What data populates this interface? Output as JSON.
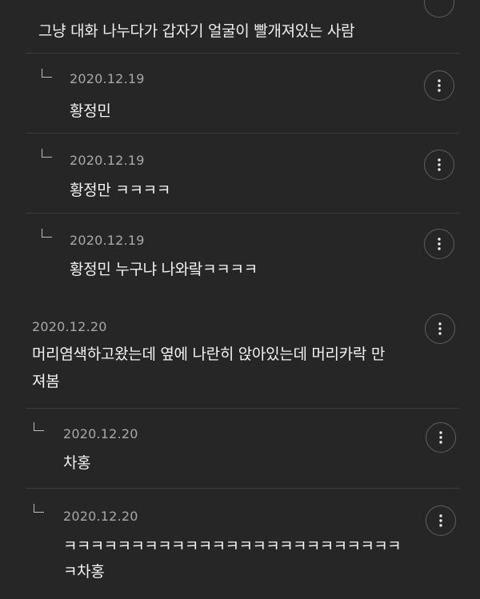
{
  "top_comment": {
    "text": "그냥 대화 나누다가 갑자기 얼굴이 빨개져있는 사람",
    "more_icon": "more-vertical-icon"
  },
  "comments": [
    {
      "type": "reply",
      "date": "2020.12.19",
      "text": "황정민"
    },
    {
      "type": "reply",
      "date": "2020.12.19",
      "text": "황정만 ㅋㅋㅋㅋ"
    },
    {
      "type": "reply",
      "date": "2020.12.19",
      "text": "황정민 누구냐 나와랔ㅋㅋㅋㅋ"
    },
    {
      "type": "comment",
      "date": "2020.12.20",
      "text_line1": "머리염색하고왔는데 옆에 나란히 앉아있는데 머리카락 만",
      "text_line2": "져봄"
    },
    {
      "type": "reply",
      "date": "2020.12.20",
      "text": "차홍"
    },
    {
      "type": "reply",
      "date": "2020.12.20",
      "text_line1": "ㅋㅋㅋㅋㅋㅋㅋㅋㅋㅋㅋㅋㅋㅋㅋㅋㅋㅋㅋㅋㅋㅋㅋㅋㅋ",
      "text_line2": "ㅋ차홍"
    }
  ],
  "icons": {
    "reply": "reply-arrow-icon",
    "more": "more-vertical-icon"
  },
  "colors": {
    "background": "#262626",
    "text": "#f2f2f2",
    "date": "#a8a8a8",
    "divider": "#3d3d3d",
    "button_border": "#5e5e5e"
  }
}
